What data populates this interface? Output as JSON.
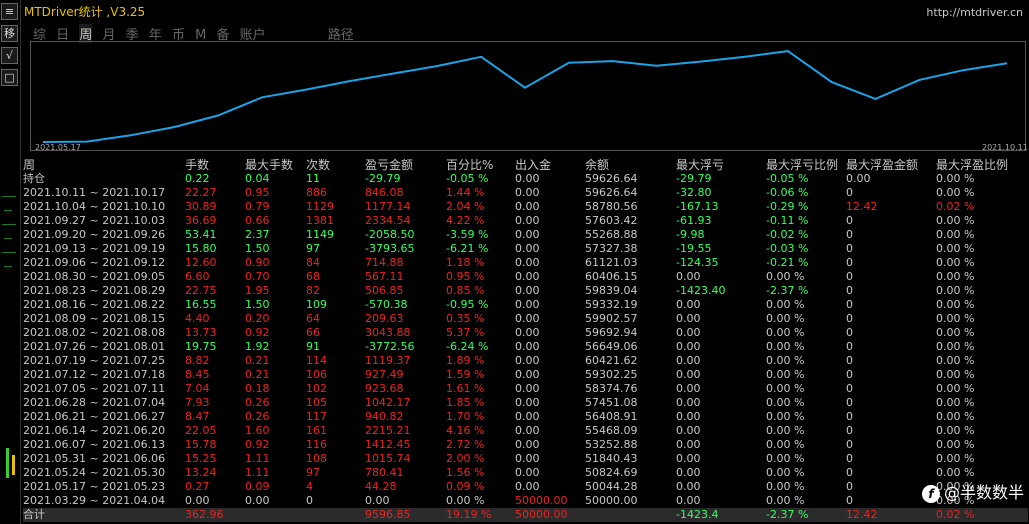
{
  "app": {
    "title": "MTDriver统计 ,V3.25",
    "url": "http://mtdriver.cn"
  },
  "tabs": [
    {
      "label": "综",
      "active": false
    },
    {
      "label": "日",
      "active": false
    },
    {
      "label": "周",
      "active": true
    },
    {
      "label": "月",
      "active": false
    },
    {
      "label": "季",
      "active": false
    },
    {
      "label": "年",
      "active": false
    },
    {
      "label": "币",
      "active": false
    },
    {
      "label": "M",
      "active": false
    },
    {
      "label": "备",
      "active": false
    },
    {
      "label": "账户",
      "active": false
    },
    {
      "label": "路径",
      "active": false
    }
  ],
  "left_toolbar": {
    "buttons": [
      "≡",
      "移",
      "√",
      "□"
    ]
  },
  "chart": {
    "start_date": "2021.05.17",
    "end_date": "2021.10.11",
    "line_color": "#1aa3e8",
    "ylim": [
      50000,
      61500
    ],
    "values": [
      50000,
      50044.28,
      50824.69,
      51840.43,
      53252.88,
      55468.09,
      56408.91,
      57451.08,
      58374.76,
      59302.25,
      60421.62,
      56649.06,
      59692.94,
      59902.57,
      59332.19,
      59839.04,
      60406.15,
      61121.03,
      57327.38,
      55268.88,
      57603.42,
      58780.56,
      59626.64
    ]
  },
  "table": {
    "headers": [
      "周",
      "手数",
      "最大手数",
      "次数",
      "盈亏金额",
      "百分比%",
      "出入金",
      "余额",
      "最大浮亏",
      "最大浮亏比例",
      "最大浮盈金额",
      "最大浮盈比例"
    ],
    "rows": [
      {
        "cells": [
          "持仓",
          "0.22",
          "0.04",
          "11",
          "-29.79",
          "-0.05 %",
          "0.00",
          "59626.64",
          "-29.79",
          "-0.05 %",
          "0.00",
          "0.00 %"
        ],
        "colors": [
          "w",
          "g",
          "g",
          "g",
          "g",
          "g",
          "w",
          "w",
          "g",
          "g",
          "w",
          "w"
        ]
      },
      {
        "cells": [
          "2021.10.11 ~ 2021.10.17",
          "22.27",
          "0.95",
          "886",
          "846.08",
          "1.44 %",
          "0.00",
          "59626.64",
          "-32.80",
          "-0.06 %",
          "0",
          "0.00 %"
        ],
        "colors": [
          "w",
          "r",
          "r",
          "r",
          "r",
          "r",
          "w",
          "w",
          "g",
          "g",
          "w",
          "w"
        ]
      },
      {
        "cells": [
          "2021.10.04 ~ 2021.10.10",
          "30.89",
          "0.79",
          "1129",
          "1177.14",
          "2.04 %",
          "0.00",
          "58780.56",
          "-167.13",
          "-0.29 %",
          "12.42",
          "0.02 %"
        ],
        "colors": [
          "w",
          "r",
          "r",
          "r",
          "r",
          "r",
          "w",
          "w",
          "g",
          "g",
          "r",
          "r"
        ]
      },
      {
        "cells": [
          "2021.09.27 ~ 2021.10.03",
          "36.69",
          "0.66",
          "1381",
          "2334.54",
          "4.22 %",
          "0.00",
          "57603.42",
          "-61.93",
          "-0.11 %",
          "0",
          "0.00 %"
        ],
        "colors": [
          "w",
          "r",
          "r",
          "r",
          "r",
          "r",
          "w",
          "w",
          "g",
          "g",
          "w",
          "w"
        ]
      },
      {
        "cells": [
          "2021.09.20 ~ 2021.09.26",
          "53.41",
          "2.37",
          "1149",
          "-2058.50",
          "-3.59 %",
          "0.00",
          "55268.88",
          "-9.98",
          "-0.02 %",
          "0",
          "0.00 %"
        ],
        "colors": [
          "w",
          "g",
          "g",
          "g",
          "g",
          "g",
          "w",
          "w",
          "g",
          "g",
          "w",
          "w"
        ]
      },
      {
        "cells": [
          "2021.09.13 ~ 2021.09.19",
          "15.80",
          "1.50",
          "97",
          "-3793.65",
          "-6.21 %",
          "0.00",
          "57327.38",
          "-19.55",
          "-0.03 %",
          "0",
          "0.00 %"
        ],
        "colors": [
          "w",
          "g",
          "g",
          "g",
          "g",
          "g",
          "w",
          "w",
          "g",
          "g",
          "w",
          "w"
        ]
      },
      {
        "cells": [
          "2021.09.06 ~ 2021.09.12",
          "12.60",
          "0.90",
          "84",
          "714.88",
          "1.18 %",
          "0.00",
          "61121.03",
          "-124.35",
          "-0.21 %",
          "0",
          "0.00 %"
        ],
        "colors": [
          "w",
          "r",
          "r",
          "r",
          "r",
          "r",
          "w",
          "w",
          "g",
          "g",
          "w",
          "w"
        ]
      },
      {
        "cells": [
          "2021.08.30 ~ 2021.09.05",
          "6.60",
          "0.70",
          "68",
          "567.11",
          "0.95 %",
          "0.00",
          "60406.15",
          "0.00",
          "0.00 %",
          "0",
          "0.00 %"
        ],
        "colors": [
          "w",
          "r",
          "r",
          "r",
          "r",
          "r",
          "w",
          "w",
          "w",
          "w",
          "w",
          "w"
        ]
      },
      {
        "cells": [
          "2021.08.23 ~ 2021.08.29",
          "22.75",
          "1.95",
          "82",
          "506.85",
          "0.85 %",
          "0.00",
          "59839.04",
          "-1423.40",
          "-2.37 %",
          "0",
          "0.00 %"
        ],
        "colors": [
          "w",
          "r",
          "r",
          "r",
          "r",
          "r",
          "w",
          "w",
          "g",
          "g",
          "w",
          "w"
        ]
      },
      {
        "cells": [
          "2021.08.16 ~ 2021.08.22",
          "16.55",
          "1.50",
          "109",
          "-570.38",
          "-0.95 %",
          "0.00",
          "59332.19",
          "0.00",
          "0.00 %",
          "0",
          "0.00 %"
        ],
        "colors": [
          "w",
          "g",
          "g",
          "g",
          "g",
          "g",
          "w",
          "w",
          "w",
          "w",
          "w",
          "w"
        ]
      },
      {
        "cells": [
          "2021.08.09 ~ 2021.08.15",
          "4.40",
          "0.20",
          "64",
          "209.63",
          "0.35 %",
          "0.00",
          "59902.57",
          "0.00",
          "0.00 %",
          "0",
          "0.00 %"
        ],
        "colors": [
          "w",
          "r",
          "r",
          "r",
          "r",
          "r",
          "w",
          "w",
          "w",
          "w",
          "w",
          "w"
        ]
      },
      {
        "cells": [
          "2021.08.02 ~ 2021.08.08",
          "13.73",
          "0.92",
          "66",
          "3043.88",
          "5.37 %",
          "0.00",
          "59692.94",
          "0.00",
          "0.00 %",
          "0",
          "0.00 %"
        ],
        "colors": [
          "w",
          "r",
          "r",
          "r",
          "r",
          "r",
          "w",
          "w",
          "w",
          "w",
          "w",
          "w"
        ]
      },
      {
        "cells": [
          "2021.07.26 ~ 2021.08.01",
          "19.75",
          "1.92",
          "91",
          "-3772.56",
          "-6.24 %",
          "0.00",
          "56649.06",
          "0.00",
          "0.00 %",
          "0",
          "0.00 %"
        ],
        "colors": [
          "w",
          "g",
          "g",
          "g",
          "g",
          "g",
          "w",
          "w",
          "w",
          "w",
          "w",
          "w"
        ]
      },
      {
        "cells": [
          "2021.07.19 ~ 2021.07.25",
          "8.82",
          "0.21",
          "114",
          "1119.37",
          "1.89 %",
          "0.00",
          "60421.62",
          "0.00",
          "0.00 %",
          "0",
          "0.00 %"
        ],
        "colors": [
          "w",
          "r",
          "r",
          "r",
          "r",
          "r",
          "w",
          "w",
          "w",
          "w",
          "w",
          "w"
        ]
      },
      {
        "cells": [
          "2021.07.12 ~ 2021.07.18",
          "8.45",
          "0.21",
          "106",
          "927.49",
          "1.59 %",
          "0.00",
          "59302.25",
          "0.00",
          "0.00 %",
          "0",
          "0.00 %"
        ],
        "colors": [
          "w",
          "r",
          "r",
          "r",
          "r",
          "r",
          "w",
          "w",
          "w",
          "w",
          "w",
          "w"
        ]
      },
      {
        "cells": [
          "2021.07.05 ~ 2021.07.11",
          "7.04",
          "0.18",
          "102",
          "923.68",
          "1.61 %",
          "0.00",
          "58374.76",
          "0.00",
          "0.00 %",
          "0",
          "0.00 %"
        ],
        "colors": [
          "w",
          "r",
          "r",
          "r",
          "r",
          "r",
          "w",
          "w",
          "w",
          "w",
          "w",
          "w"
        ]
      },
      {
        "cells": [
          "2021.06.28 ~ 2021.07.04",
          "7.93",
          "0.26",
          "105",
          "1042.17",
          "1.85 %",
          "0.00",
          "57451.08",
          "0.00",
          "0.00 %",
          "0",
          "0.00 %"
        ],
        "colors": [
          "w",
          "r",
          "r",
          "r",
          "r",
          "r",
          "w",
          "w",
          "w",
          "w",
          "w",
          "w"
        ]
      },
      {
        "cells": [
          "2021.06.21 ~ 2021.06.27",
          "8.47",
          "0.26",
          "117",
          "940.82",
          "1.70 %",
          "0.00",
          "56408.91",
          "0.00",
          "0.00 %",
          "0",
          "0.00 %"
        ],
        "colors": [
          "w",
          "r",
          "r",
          "r",
          "r",
          "r",
          "w",
          "w",
          "w",
          "w",
          "w",
          "w"
        ]
      },
      {
        "cells": [
          "2021.06.14 ~ 2021.06.20",
          "22.05",
          "1.60",
          "161",
          "2215.21",
          "4.16 %",
          "0.00",
          "55468.09",
          "0.00",
          "0.00 %",
          "0",
          "0.00 %"
        ],
        "colors": [
          "w",
          "r",
          "r",
          "r",
          "r",
          "r",
          "w",
          "w",
          "w",
          "w",
          "w",
          "w"
        ]
      },
      {
        "cells": [
          "2021.06.07 ~ 2021.06.13",
          "15.78",
          "0.92",
          "116",
          "1412.45",
          "2.72 %",
          "0.00",
          "53252.88",
          "0.00",
          "0.00 %",
          "0",
          "0.00 %"
        ],
        "colors": [
          "w",
          "r",
          "r",
          "r",
          "r",
          "r",
          "w",
          "w",
          "w",
          "w",
          "w",
          "w"
        ]
      },
      {
        "cells": [
          "2021.05.31 ~ 2021.06.06",
          "15.25",
          "1.11",
          "108",
          "1015.74",
          "2.00 %",
          "0.00",
          "51840.43",
          "0.00",
          "0.00 %",
          "0",
          "0.00 %"
        ],
        "colors": [
          "w",
          "r",
          "r",
          "r",
          "r",
          "r",
          "w",
          "w",
          "w",
          "w",
          "w",
          "w"
        ]
      },
      {
        "cells": [
          "2021.05.24 ~ 2021.05.30",
          "13.24",
          "1.11",
          "97",
          "780.41",
          "1.56 %",
          "0.00",
          "50824.69",
          "0.00",
          "0.00 %",
          "0",
          "0.00 %"
        ],
        "colors": [
          "w",
          "r",
          "r",
          "r",
          "r",
          "r",
          "w",
          "w",
          "w",
          "w",
          "w",
          "w"
        ]
      },
      {
        "cells": [
          "2021.05.17 ~ 2021.05.23",
          "0.27",
          "0.09",
          "4",
          "44.28",
          "0.09 %",
          "0.00",
          "50044.28",
          "0.00",
          "0.00 %",
          "0",
          "0.00 %"
        ],
        "colors": [
          "w",
          "r",
          "r",
          "r",
          "r",
          "r",
          "w",
          "w",
          "w",
          "w",
          "w",
          "w"
        ]
      },
      {
        "cells": [
          "2021.03.29 ~ 2021.04.04",
          "0.00",
          "0.00",
          "0",
          "0.00",
          "0.00 %",
          "50000.00",
          "50000.00",
          "0.00",
          "0.00 %",
          "0",
          "0.00 %"
        ],
        "colors": [
          "w",
          "w",
          "w",
          "w",
          "w",
          "w",
          "r",
          "w",
          "w",
          "w",
          "w",
          "w"
        ]
      }
    ],
    "total": {
      "cells": [
        "合计",
        "362.96",
        "",
        "",
        "9596.85",
        "19.19 %",
        "50000.00",
        "",
        "-1423.4",
        "-2.37 %",
        "12.42",
        "0.02 %"
      ],
      "colors": [
        "w",
        "r",
        "r",
        "r",
        "r",
        "r",
        "r",
        "w",
        "g",
        "g",
        "r",
        "r"
      ]
    }
  },
  "watermark": {
    "text": "@半数数半",
    "logo": "f"
  }
}
